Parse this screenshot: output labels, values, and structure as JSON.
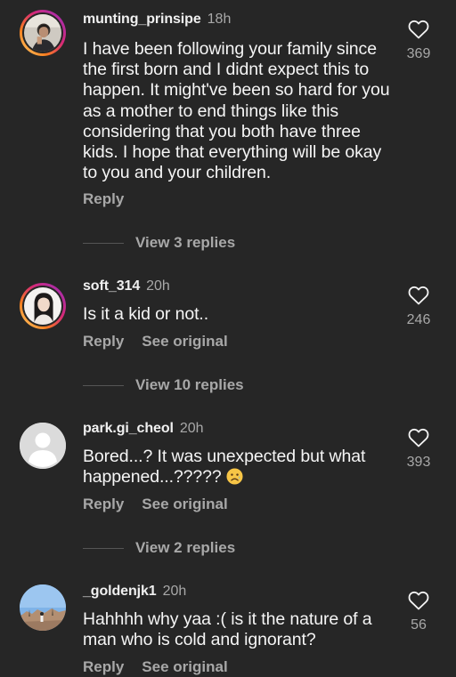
{
  "comments": [
    {
      "username": "munting_prinsipe",
      "time": "18h",
      "text": "I have been following your family since the first born and I didnt expect this to happen. It might've been so hard for you as a mother to end things like this considering that you both have three kids. I hope that everything will be okay to you and your children.",
      "reply_label": "Reply",
      "likes": "369",
      "view_replies": "View 3 replies",
      "avatar_icon": "avatar-photo-icon",
      "has_story": true
    },
    {
      "username": "soft_314",
      "time": "20h",
      "text": "Is it a kid or not..",
      "reply_label": "Reply",
      "see_original_label": "See original",
      "likes": "246",
      "view_replies": "View 10 replies",
      "avatar_icon": "avatar-photo-icon",
      "has_story": true
    },
    {
      "username": "park.gi_cheol",
      "time": "20h",
      "text": "Bored...? It was unexpected but what happened...?????",
      "emoji": "sad-face-emoji",
      "reply_label": "Reply",
      "see_original_label": "See original",
      "likes": "393",
      "view_replies": "View 2 replies",
      "avatar_icon": "default-avatar-icon",
      "has_story": false
    },
    {
      "username": "_goldenjk1",
      "time": "20h",
      "text": "Hahhhh why yaa :( is it the nature of a man who is cold and ignorant?",
      "reply_label": "Reply",
      "see_original_label": "See original",
      "likes": "56",
      "avatar_icon": "avatar-photo-icon",
      "has_story": false
    }
  ],
  "colors": {
    "background": "#262626",
    "primary_text": "#f5f5f5",
    "secondary_text": "#a8a8a8",
    "story_ring": [
      "#feda75",
      "#fa7e1e",
      "#d62976",
      "#962fbf"
    ]
  }
}
